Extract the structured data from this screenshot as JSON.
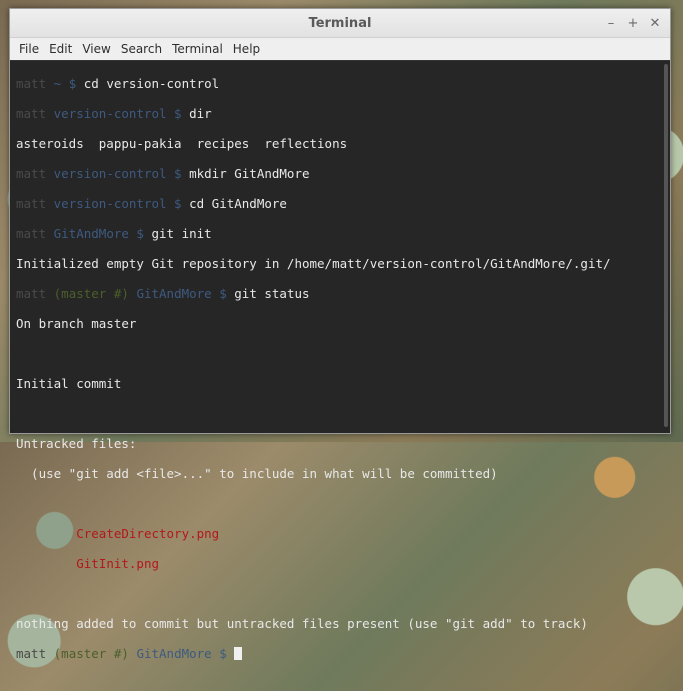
{
  "window": {
    "title": "Terminal"
  },
  "menu": [
    "File",
    "Edit",
    "View",
    "Search",
    "Terminal",
    "Help"
  ],
  "terminal": {
    "l1_user": "matt",
    "l1_path": "~ $",
    "l1_cmd": " cd version-control",
    "l2_user": "matt",
    "l2_path": "version-control $",
    "l2_cmd": " dir",
    "l3": "asteroids  pappu-pakia  recipes  reflections",
    "l4_user": "matt",
    "l4_path": "version-control $",
    "l4_cmd": " mkdir GitAndMore",
    "l5_user": "matt",
    "l5_path": "version-control $",
    "l5_cmd": " cd GitAndMore",
    "l6_user": "matt",
    "l6_path": "GitAndMore $",
    "l6_cmd": " git init",
    "l7": "Initialized empty Git repository in /home/matt/version-control/GitAndMore/.git/",
    "l8_user": "matt",
    "l8_branch": "(master #)",
    "l8_path": "GitAndMore $",
    "l8_cmd": " git status",
    "l9": "On branch master",
    "l11": "Initial commit",
    "l13": "Untracked files:",
    "l14": "  (use \"git add <file>...\" to include in what will be committed)",
    "l16": "\tCreateDirectory.png",
    "l17": "\tGitInit.png",
    "l19": "nothing added to commit but untracked files present (use \"git add\" to track)",
    "l20_user": "matt",
    "l20_branch": "(master #)",
    "l20_path": "GitAndMore $"
  }
}
